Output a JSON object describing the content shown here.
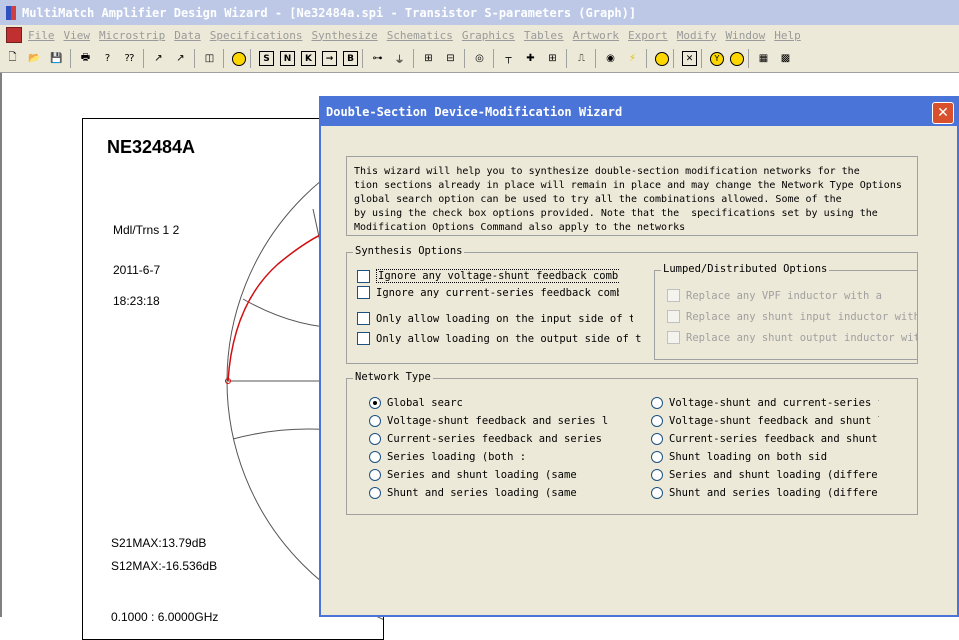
{
  "window": {
    "title": "MultiMatch Amplifier Design Wizard - [Ne32484a.spi - Transistor S-parameters (Graph)]"
  },
  "menu": {
    "items": [
      "File",
      "View",
      "Microstrip",
      "Data",
      "Specifications",
      "Synthesize",
      "Schematics",
      "Graphics",
      "Tables",
      "Artwork",
      "Export",
      "Modify",
      "Window",
      "Help"
    ]
  },
  "toolbar": {
    "icons": [
      "new-icon",
      "open-icon",
      "save-icon",
      "print-icon",
      "help-icon",
      "context-help-icon",
      "arrow-a-icon",
      "arrow-a2-icon",
      "split-icon",
      "circle-b-icon",
      "box-s-icon",
      "box-n-icon",
      "box-k-icon",
      "box-arrow-icon",
      "box-b-icon",
      "lumped-icon",
      "ground-icon",
      "network-icon",
      "network2-icon",
      "target-icon",
      "tee-icon",
      "plus-icon",
      "box-plus-icon",
      "pulse-icon",
      "ring-icon",
      "lightning-icon",
      "dot-icon",
      "x-box-icon",
      "y-circle-icon",
      "dot-circle-icon",
      "chip-icon",
      "chip2-icon"
    ],
    "box_labels": {
      "s": "S",
      "n": "N",
      "k": "K",
      "b": "B",
      "y": "Y"
    }
  },
  "plot": {
    "device": "NE32484A",
    "mode": "Mdl/Trns 1 2",
    "date": "2011-6-7",
    "time": "18:23:18",
    "s21max": "S21MAX:13.79dB",
    "s12max": "S12MAX:-16.536dB",
    "freq": "0.1000 : 6.0000GHz",
    "trace_color": "#d01010"
  },
  "dialog": {
    "title": "Double-Section Device-Modification Wizard",
    "info_lines": [
      "This wizard will help you to synthesize double-section modification networks for the",
      "tion sections already in place will remain in place and may change the Network Type Options",
      "global search option can be used to try all the combinations allowed. Some of the",
      "by using the check box options provided. Note that the  specifications set by using the",
      "Modification Options Command also apply to the networks"
    ],
    "synthesis": {
      "title": "Synthesis Options",
      "options": [
        "Ignore any voltage-shunt feedback combi",
        "Ignore any current-series feedback comb:",
        "Only allow loading on the input side of tl",
        "Only allow loading on the output  side of t"
      ]
    },
    "lumped": {
      "title": "Lumped/Distributed Options",
      "options": [
        "Replace any VPF inductor with a",
        "Replace any shunt input inductor with",
        "Replace any shunt output inductor wit"
      ]
    },
    "network": {
      "title": "Network Type",
      "left": [
        "Global searc",
        "Voltage-shunt feedback and series l",
        "Current-series feedback and series",
        "Series loading (both :",
        "Series and shunt loading (same",
        "Shunt and series loading (same"
      ],
      "right": [
        "Voltage-shunt and current-series fe",
        "Voltage-shunt feedback and shunt lo",
        "Current-series feedback and shunt l",
        "Shunt loading on both sid",
        "Series and shunt loading (differe",
        "Shunt and series loading (differe"
      ],
      "selected": "Global searc"
    }
  }
}
